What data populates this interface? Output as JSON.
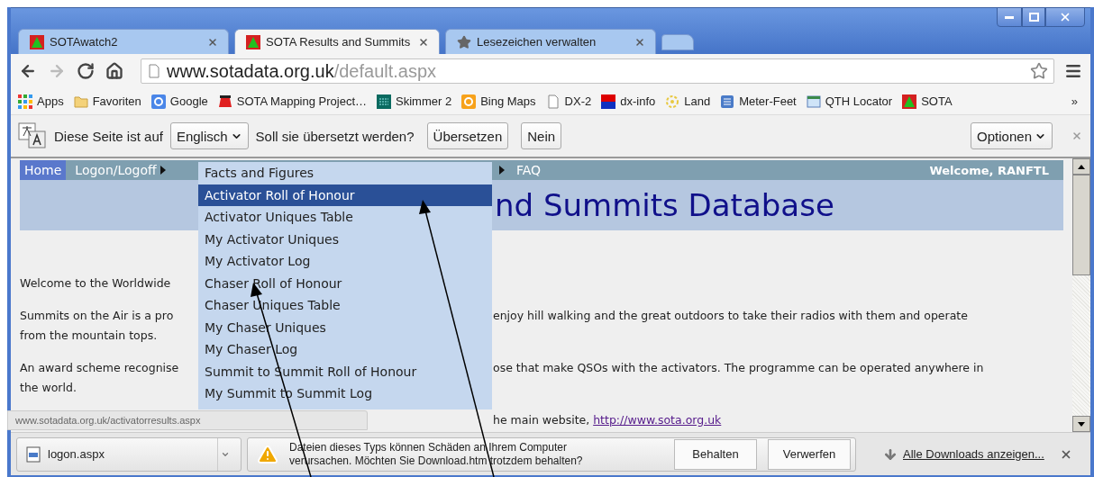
{
  "tabs": [
    {
      "title": "SOTAwatch2",
      "kind": "mountain",
      "selected": false
    },
    {
      "title": "SOTA Results and Summits",
      "kind": "mountain",
      "selected": true
    },
    {
      "title": "Lesezeichen verwalten",
      "kind": "star",
      "selected": false
    }
  ],
  "nav_buttons": [
    {
      "kind": "back",
      "disabled": false
    },
    {
      "kind": "forward",
      "disabled": true
    },
    {
      "kind": "reload",
      "disabled": false
    },
    {
      "kind": "home",
      "disabled": false
    }
  ],
  "address": {
    "host": "www.sotadata.org.uk",
    "path": "/default.aspx"
  },
  "bookmarks": [
    {
      "label": "Apps",
      "kind": "apps"
    },
    {
      "label": "Favoriten",
      "kind": "folder"
    },
    {
      "label": "Google",
      "kind": "google"
    },
    {
      "label": "SOTA Mapping Project…",
      "kind": "smp"
    },
    {
      "label": "Skimmer 2",
      "kind": "skimmer"
    },
    {
      "label": "Bing Maps",
      "kind": "bing"
    },
    {
      "label": "DX-2",
      "kind": "page"
    },
    {
      "label": "dx-info",
      "kind": "dx"
    },
    {
      "label": "Land",
      "kind": "flower"
    },
    {
      "label": "Meter-Feet",
      "kind": "table"
    },
    {
      "label": "QTH  Locator",
      "kind": "window"
    },
    {
      "label": "SOTA",
      "kind": "mountain"
    }
  ],
  "bookmarks_overflow": "»",
  "translate_bar": {
    "prefix": "Diese Seite ist auf",
    "language": "Englisch",
    "question": "Soll sie übersetzt werden?",
    "buttons": [
      "Übersetzen",
      "Nein"
    ],
    "options": "Optionen"
  },
  "page": {
    "nav": [
      {
        "label": "Home",
        "selected": true,
        "submenu": false
      },
      {
        "label": "Logon/Logoff",
        "selected": false,
        "submenu": true
      }
    ],
    "nav_right": "FAQ",
    "welcome": "Welcome, RANFTL",
    "banner_title": "nd Summits Database",
    "paragraphs": [
      {
        "lines": [
          {
            "left": "Welcome to the Worldwide"
          }
        ]
      },
      {
        "lines": [
          {
            "left": "Summits on the Air is a pro",
            "right": "enjoy hill walking and the great outdoors to take their radios with them and operate"
          },
          {
            "left": "from the mountain tops."
          }
        ]
      },
      {
        "lines": [
          {
            "left": "An award scheme recognise",
            "right": "ose that make QSOs with the activators. The programme can be operated anywhere in"
          },
          {
            "left": "the world."
          }
        ]
      },
      {
        "lines": [
          {
            "right": "he main website, ",
            "link": "http://www.sota.org.uk"
          }
        ]
      }
    ]
  },
  "dropdown": [
    {
      "label": "Facts and Figures",
      "selected": false
    },
    {
      "label": "Activator Roll of Honour",
      "selected": true
    },
    {
      "label": "Activator Uniques Table",
      "selected": false
    },
    {
      "label": "My Activator Uniques",
      "selected": false
    },
    {
      "label": "My Activator Log",
      "selected": false
    },
    {
      "label": "Chaser Roll of Honour",
      "selected": false
    },
    {
      "label": "Chaser Uniques Table",
      "selected": false
    },
    {
      "label": "My Chaser Uniques",
      "selected": false
    },
    {
      "label": "My Chaser Log",
      "selected": false
    },
    {
      "label": "Summit to Summit Roll of Honour",
      "selected": false
    },
    {
      "label": "My Summit to Summit Log",
      "selected": false
    }
  ],
  "status_url": "www.sotadata.org.uk/activatorresults.aspx",
  "downloads": {
    "file": "logon.aspx",
    "warning": [
      "Dateien dieses Typs können Schäden an Ihrem Computer",
      "verursachen. Möchten Sie Download.htm trotzdem behalten?"
    ],
    "buttons": [
      "Behalten",
      "Verwerfen"
    ],
    "show_all": "Alle Downloads anzeigen..."
  }
}
